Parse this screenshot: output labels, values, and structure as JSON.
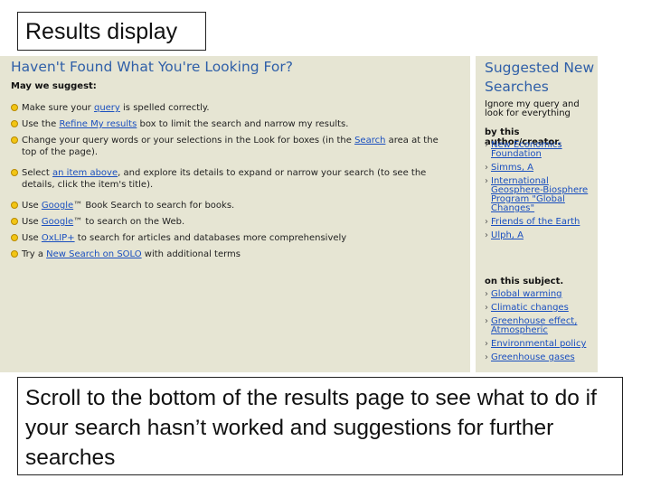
{
  "slide_title": "Results display",
  "left_panel": {
    "heading": "Haven't Found What You're Looking For?",
    "subheading": "May we suggest:",
    "suggestions": [
      {
        "pre": "Make sure your ",
        "link": "query",
        "post": " is spelled correctly."
      },
      {
        "pre": "Use the ",
        "link": "Refine My results",
        "post": " box to limit the search and narrow my results."
      },
      {
        "pre": "Change your query words or your selections in the Look for boxes (in the ",
        "link": "Search",
        "post": " area at the top of the page)."
      },
      {
        "pre": "Select ",
        "link": "an item above",
        "post": ", and explore its details to expand or narrow your search (to see the details, click the item's title)."
      },
      {
        "pre": "Use ",
        "link": "Google",
        "post": "™ Book Search to search for books."
      },
      {
        "pre": "Use ",
        "link": "Google",
        "post": "™ to search on the Web."
      },
      {
        "pre": "Use ",
        "link": "OxLIP+",
        "post": " to search for articles and databases more comprehensively"
      },
      {
        "pre": "Try a ",
        "link": "New Search on SOLO",
        "post": " with additional terms"
      }
    ]
  },
  "right_panel": {
    "heading": "Suggested New Searches",
    "note": "Ignore my query and look for everything",
    "author_label": "by this author/creator.",
    "authors": [
      "New Economics Foundation",
      "Simms, A",
      "International Geosphere-Biosphere Program \"Global Changes\"",
      "Friends of the Earth",
      "Ulph, A"
    ],
    "subject_label": "on this subject.",
    "subjects": [
      "Global warming",
      "Climatic changes",
      "Greenhouse effect, Atmospheric",
      "Environmental policy",
      "Greenhouse gases"
    ]
  },
  "caption": "Scroll to the bottom of the results page to see what to do if your search hasn’t worked and suggestions for further searches",
  "colors": {
    "panel_bg": "#e6e5d3",
    "heading": "#2f5fa8",
    "link": "#1a4fbf",
    "bullet": "#f2c514"
  }
}
